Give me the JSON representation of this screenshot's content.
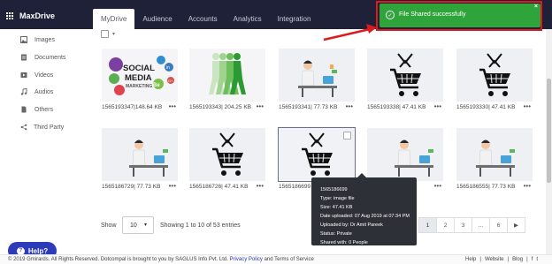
{
  "app": {
    "name": "MaxDrive"
  },
  "tabs": [
    {
      "label": "MyDrive",
      "active": true
    },
    {
      "label": "Audience",
      "active": false
    },
    {
      "label": "Accounts",
      "active": false
    },
    {
      "label": "Analytics",
      "active": false
    },
    {
      "label": "Integration",
      "active": false
    }
  ],
  "sidebar": {
    "items": [
      {
        "label": "Images",
        "icon": "image-icon"
      },
      {
        "label": "Documents",
        "icon": "document-icon"
      },
      {
        "label": "Videos",
        "icon": "video-icon"
      },
      {
        "label": "Audios",
        "icon": "music-icon"
      },
      {
        "label": "Others",
        "icon": "file-icon"
      },
      {
        "label": "Third Party",
        "icon": "share-icon"
      }
    ]
  },
  "files": [
    {
      "name": "1565193347",
      "size": "148.64 KB",
      "kind": "social"
    },
    {
      "name": "1565193343",
      "size": "204.25 KB",
      "kind": "walker"
    },
    {
      "name": "1565193341",
      "size": "77.73 KB",
      "kind": "desk"
    },
    {
      "name": "1565193338",
      "size": "47.41 KB",
      "kind": "cart"
    },
    {
      "name": "1565193330",
      "size": "47.41 KB",
      "kind": "cart"
    },
    {
      "name": "1565186729",
      "size": "77.73 KB",
      "kind": "desk"
    },
    {
      "name": "1565186726",
      "size": "47.41 KB",
      "kind": "cart"
    },
    {
      "name": "1565186699",
      "size": "",
      "kind": "cart",
      "selected": true
    },
    {
      "name": "",
      "size": "",
      "kind": "desk"
    },
    {
      "name": "1565186555",
      "size": "77.73 KB",
      "kind": "desk"
    }
  ],
  "thumb_text": {
    "social_1": "SOCIAL",
    "social_2": "MEDIA",
    "social_3": "MARKETING",
    "be": "Be",
    "gplus": "G+",
    "in": "in"
  },
  "more_glyph": "•••",
  "tooltip": {
    "name": "1565186699",
    "type": "Type: image file",
    "size": "Size: 47.41 KB",
    "date": "Date uploaded: 07 Aug 2019 at 07:34 PM",
    "uploader": "Uploaded by: Dr Amit Pareek",
    "status": "Status: Private",
    "shared": "Shared with: 0 People"
  },
  "pagination": {
    "show_label": "Show",
    "page_size": "10",
    "showing": "Showing 1 to 10 of 53 entries",
    "pages": [
      "1",
      "2",
      "3",
      "...",
      "6",
      "▶"
    ],
    "active_page": "1"
  },
  "help": {
    "label": "Help?"
  },
  "footer": {
    "copyright": "© 2019 Gmirards. All Rights Reserved. Dotcompal is brought to you by SAGLUS Info Pvt. Ltd.",
    "privacy": "Privacy Policy",
    "and_terms": "and Terms of Service",
    "links": [
      "Help",
      "|",
      "Website",
      "|",
      "Blog",
      "|",
      "f",
      "t"
    ]
  },
  "toast": {
    "message": "File Shared successfully",
    "close": "×"
  },
  "colors": {
    "topbar": "#1f2138",
    "toast_bg": "#2fa43b",
    "annotation_red": "#e0191c",
    "help_blue": "#2e3bb8"
  }
}
